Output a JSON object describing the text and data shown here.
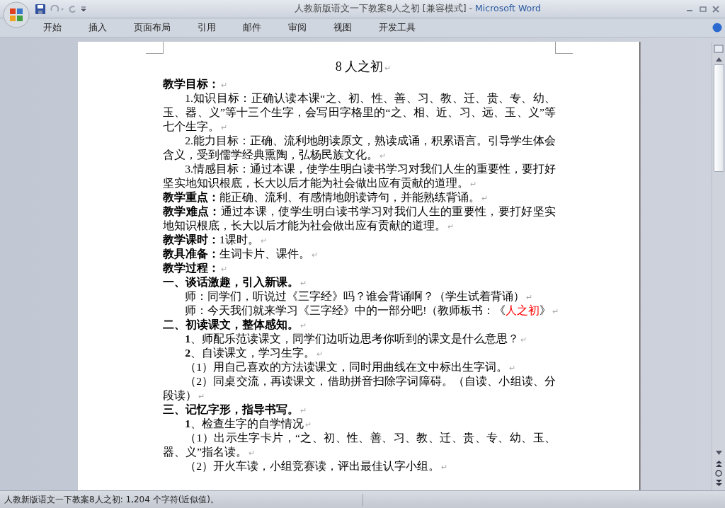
{
  "window": {
    "title": "人教新版语文一下教案8人之初 [兼容模式]",
    "separator": "-",
    "app_name": "Microsoft Word"
  },
  "ribbon_tabs": [
    {
      "label": "开始",
      "selected": false
    },
    {
      "label": "插入",
      "selected": false
    },
    {
      "label": "页面布局",
      "selected": false
    },
    {
      "label": "引用",
      "selected": false
    },
    {
      "label": "邮件",
      "selected": false
    },
    {
      "label": "审阅",
      "selected": false
    },
    {
      "label": "视图",
      "selected": false
    },
    {
      "label": "开发工具",
      "selected": false
    }
  ],
  "document": {
    "paragraphs": [
      {
        "kind": "title",
        "segments": [
          {
            "text": "8 人之初"
          }
        ],
        "mark": "↵"
      },
      {
        "kind": "heading",
        "segments": [
          {
            "text": "**教学目标：**"
          }
        ],
        "mark": "↵"
      },
      {
        "kind": "indented",
        "segments": [
          {
            "text": "1.知识目标：正确认读本课“之、初、性、善、习、教、迁、贵、专、幼、玉、器、义”等十三个生字，会写田字格里的“之、相、近、习、远、玉、义”等七个生字。"
          }
        ],
        "mark": "↵"
      },
      {
        "kind": "indented",
        "segments": [
          {
            "text": "2.能力目标：正确、流利地朗读原文，熟读成诵，积累语言。引导学生体会含义，受到儒学经典熏陶，弘杨民族文化。"
          }
        ],
        "mark": "↵"
      },
      {
        "kind": "indented",
        "segments": [
          {
            "text": "3.情感目标：通过本课，使学生明白读书学习对我们人生的重要性，要打好坚实地知识根底，长大以后才能为社会做出应有贡献的道理。"
          }
        ],
        "mark": "↵"
      },
      {
        "kind": "heading",
        "segments": [
          {
            "text": "**教学重点：**能正确、流利、有感情地朗读诗句，并能熟练背诵。"
          }
        ],
        "mark": "↵"
      },
      {
        "kind": "heading",
        "segments": [
          {
            "text": "**教学难点：**通过本课，使学生明白读书学习对我们人生的重要性，要打好坚实地知识根底，长大以后才能为社会做出应有贡献的道理。"
          }
        ],
        "mark": "↵"
      },
      {
        "kind": "heading",
        "segments": [
          {
            "text": "**教学课时：**1课时。"
          }
        ],
        "mark": "↵"
      },
      {
        "kind": "heading",
        "segments": [
          {
            "text": "**教具准备：**生词卡片、课件。"
          }
        ],
        "mark": "↵"
      },
      {
        "kind": "heading",
        "segments": [
          {
            "text": "**教学过程：**"
          }
        ],
        "mark": "↵"
      },
      {
        "kind": "heading",
        "segments": [
          {
            "text": "**一、谈话激趣，引入新课。**"
          }
        ],
        "mark": "↵"
      },
      {
        "kind": "indented",
        "segments": [
          {
            "text": "师：同学们，听说过《三字经》吗？谁会背诵啊？（学生试着背诵）"
          }
        ],
        "mark": "↵"
      },
      {
        "kind": "indented",
        "segments": [
          {
            "text": "师：今天我们就来学习《三字经》中的一部分吧!（教师板书：《"
          },
          {
            "text": "人之初",
            "color": "#ff0000"
          },
          {
            "text": "》"
          }
        ],
        "mark": "↵"
      },
      {
        "kind": "heading",
        "segments": [
          {
            "text": "**二、初读课文，整体感知。**"
          }
        ],
        "mark": "↵"
      },
      {
        "kind": "indented",
        "segments": [
          {
            "text": "**1**、师配乐范读课文，同学们边听边思考你听到的课文是什么意思？"
          }
        ],
        "mark": "↵"
      },
      {
        "kind": "indented",
        "segments": [
          {
            "text": "**2**、自读课文，学习生字。"
          }
        ],
        "mark": "↵"
      },
      {
        "kind": "indented",
        "segments": [
          {
            "text": "（1）用自己喜欢的方法读课文，同时用曲线在文中标出生字词。"
          }
        ],
        "mark": "↵"
      },
      {
        "kind": "indented",
        "segments": [
          {
            "text": "（2）同桌交流，再读课文，借助拼音扫除字词障碍。（自读、小组读、分段读）"
          }
        ],
        "mark": "↵"
      },
      {
        "kind": "heading",
        "segments": [
          {
            "text": "**三、记忆字形，指导书写。**"
          }
        ],
        "mark": "↵"
      },
      {
        "kind": "indented",
        "segments": [
          {
            "text": "**1**、检查生字的自学情况"
          }
        ],
        "mark": "↵"
      },
      {
        "kind": "indented",
        "segments": [
          {
            "text": "（1）出示生字卡片，“之、初、性、善、习、教、迁、贵、专、幼、玉、器、义”指名读。"
          }
        ],
        "mark": "↵"
      },
      {
        "kind": "indented",
        "segments": [
          {
            "text": "（2）开火车读，小组竞赛读，评出最佳认字小组。"
          }
        ],
        "mark": "↵"
      }
    ]
  },
  "status_bar": {
    "text": "人教新版语文一下教案8人之初: 1,204 个字符(近似值)。"
  }
}
